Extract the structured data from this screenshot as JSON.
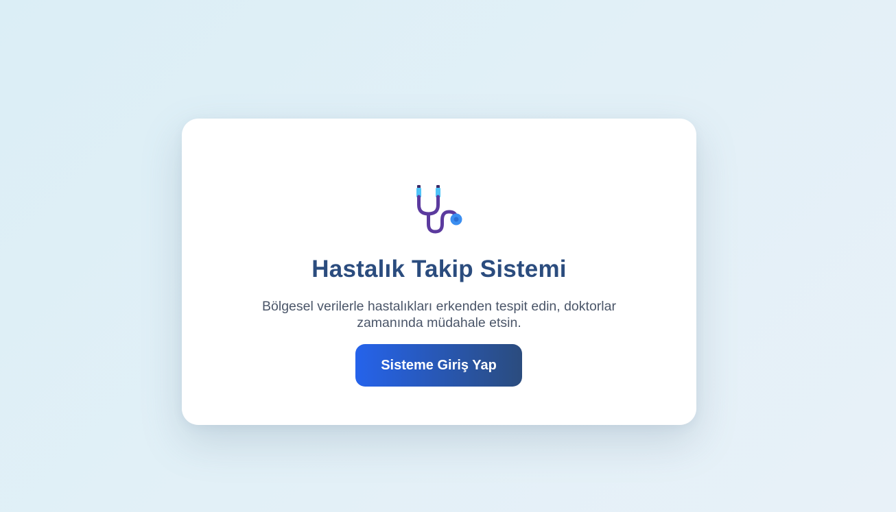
{
  "hero": {
    "icon": "stethoscope-icon",
    "title": "Hastalık Takip Sistemi",
    "subtitle": "Bölgesel verilerle hastalıkları erkenden tespit edin, doktorlar zamanında müdahale etsin.",
    "cta_label": "Sisteme Giriş Yap"
  },
  "colors": {
    "title": "#2b4c7e",
    "subtitle": "#4a5568",
    "button_start": "#2563eb",
    "button_end": "#2b4c7e",
    "icon_tube": "#5b3a9e",
    "icon_earpiece": "#4fc3f7",
    "icon_chest": "#3b8ef0"
  }
}
